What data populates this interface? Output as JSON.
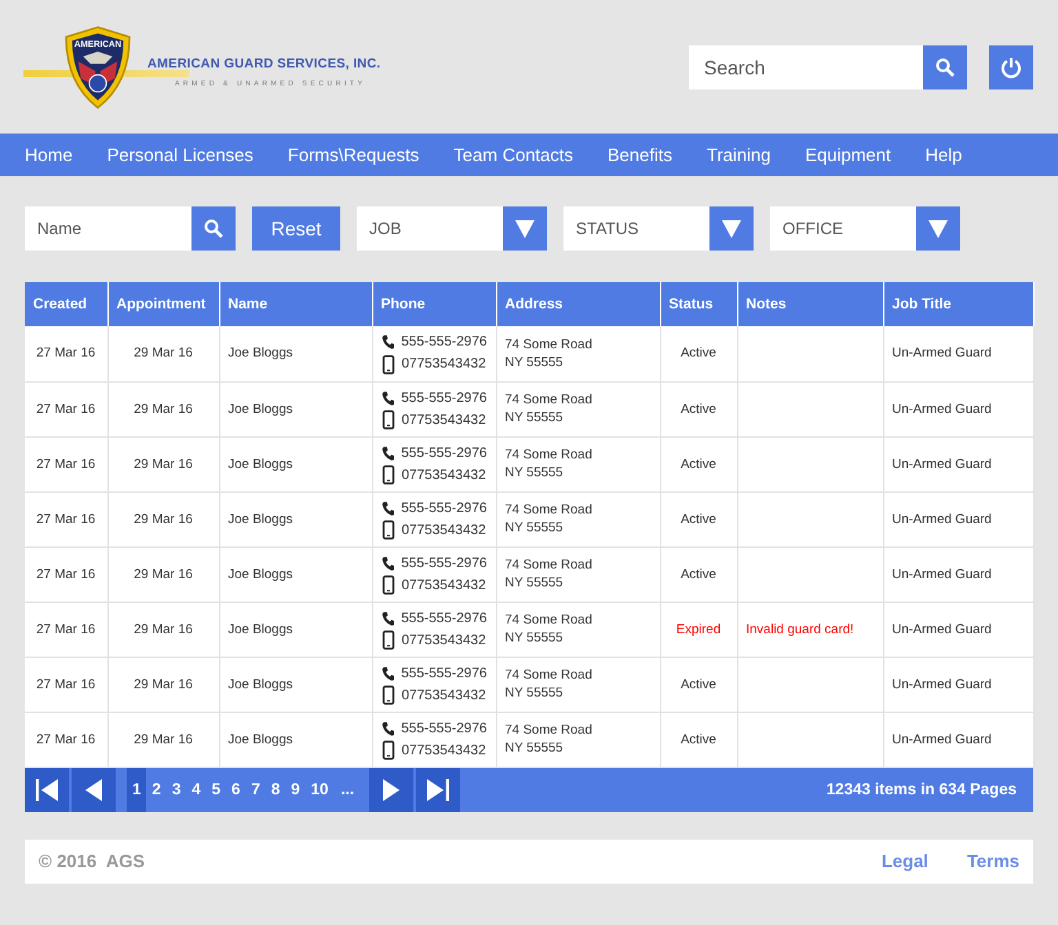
{
  "logo": {
    "badge_text": "AMERICAN",
    "company": "AMERICAN GUARD SERVICES, INC.",
    "tagline": "ARMED & UNARMED SECURITY"
  },
  "search": {
    "placeholder": "Search"
  },
  "nav": [
    {
      "label": "Home"
    },
    {
      "label": "Personal Licenses"
    },
    {
      "label": "Forms\\Requests"
    },
    {
      "label": "Team Contacts"
    },
    {
      "label": "Benefits"
    },
    {
      "label": "Training"
    },
    {
      "label": "Equipment"
    },
    {
      "label": "Help"
    }
  ],
  "filters": {
    "name_placeholder": "Name",
    "reset": "Reset",
    "dropdowns": [
      {
        "label": "JOB"
      },
      {
        "label": "STATUS"
      },
      {
        "label": "OFFICE"
      }
    ]
  },
  "table": {
    "columns": [
      "Created",
      "Appointment",
      "Name",
      "Phone",
      "Address",
      "Status",
      "Notes",
      "Job Title"
    ],
    "rows": [
      {
        "created": "27 Mar 16",
        "appointment": "29 Mar 16",
        "name": "Joe Bloggs",
        "phone": "555-555-2976",
        "mobile": "07753543432",
        "address": [
          "74 Some Road",
          "NY 55555"
        ],
        "status": "Active",
        "notes": "",
        "job_title": "Un-Armed Guard",
        "flagged": false
      },
      {
        "created": "27 Mar 16",
        "appointment": "29 Mar 16",
        "name": "Joe Bloggs",
        "phone": "555-555-2976",
        "mobile": "07753543432",
        "address": [
          "74 Some Road",
          "NY 55555"
        ],
        "status": "Active",
        "notes": "",
        "job_title": "Un-Armed Guard",
        "flagged": false
      },
      {
        "created": "27 Mar 16",
        "appointment": "29 Mar 16",
        "name": "Joe Bloggs",
        "phone": "555-555-2976",
        "mobile": "07753543432",
        "address": [
          "74 Some Road",
          "NY 55555"
        ],
        "status": "Active",
        "notes": "",
        "job_title": "Un-Armed Guard",
        "flagged": false
      },
      {
        "created": "27 Mar 16",
        "appointment": "29 Mar 16",
        "name": "Joe Bloggs",
        "phone": "555-555-2976",
        "mobile": "07753543432",
        "address": [
          "74 Some Road",
          "NY 55555"
        ],
        "status": "Active",
        "notes": "",
        "job_title": "Un-Armed Guard",
        "flagged": false
      },
      {
        "created": "27 Mar 16",
        "appointment": "29 Mar 16",
        "name": "Joe Bloggs",
        "phone": "555-555-2976",
        "mobile": "07753543432",
        "address": [
          "74 Some Road",
          "NY 55555"
        ],
        "status": "Active",
        "notes": "",
        "job_title": "Un-Armed Guard",
        "flagged": false
      },
      {
        "created": "27 Mar 16",
        "appointment": "29 Mar 16",
        "name": "Joe Bloggs",
        "phone": "555-555-2976",
        "mobile": "07753543432",
        "address": [
          "74 Some Road",
          "NY 55555"
        ],
        "status": "Expired",
        "notes": "Invalid guard card!",
        "job_title": "Un-Armed Guard",
        "flagged": true
      },
      {
        "created": "27 Mar 16",
        "appointment": "29 Mar 16",
        "name": "Joe Bloggs",
        "phone": "555-555-2976",
        "mobile": "07753543432",
        "address": [
          "74 Some Road",
          "NY 55555"
        ],
        "status": "Active",
        "notes": "",
        "job_title": "Un-Armed Guard",
        "flagged": false
      },
      {
        "created": "27 Mar 16",
        "appointment": "29 Mar 16",
        "name": "Joe Bloggs",
        "phone": "555-555-2976",
        "mobile": "07753543432",
        "address": [
          "74 Some Road",
          "NY 55555"
        ],
        "status": "Active",
        "notes": "",
        "job_title": "Un-Armed Guard",
        "flagged": false
      }
    ]
  },
  "pager": {
    "pages": [
      {
        "label": "1",
        "selected": true
      },
      {
        "label": "2",
        "selected": false
      },
      {
        "label": "3",
        "selected": false
      },
      {
        "label": "4",
        "selected": false
      },
      {
        "label": "5",
        "selected": false
      },
      {
        "label": "6",
        "selected": false
      },
      {
        "label": "7",
        "selected": false
      },
      {
        "label": "8",
        "selected": false
      },
      {
        "label": "9",
        "selected": false
      },
      {
        "label": "10",
        "selected": false
      }
    ],
    "ellipsis": "...",
    "summary": "12343 items in 634 Pages"
  },
  "footer": {
    "copyright": "© 2016  AGS",
    "links": [
      "Legal",
      "Terms"
    ]
  }
}
